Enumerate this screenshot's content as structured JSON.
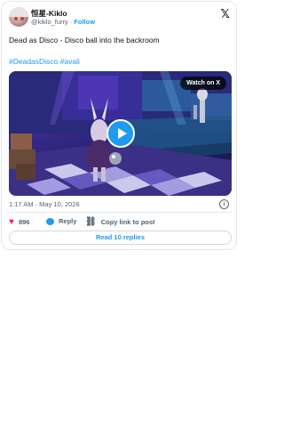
{
  "author": {
    "display_name": "恒星-Kiklo",
    "handle": "@kiklo_furry",
    "separator": "·",
    "follow_label": "Follow"
  },
  "brand_logo": "𝕏",
  "tweet": {
    "text": "Dead as Disco - Disco ball into the backroom",
    "hashtags": [
      "#DeadasDisco",
      "#avali"
    ]
  },
  "media": {
    "watch_label": "Watch on X",
    "play_icon": "play-icon"
  },
  "timestamp": "1:17 AM · May 10, 2026",
  "actions": {
    "like_count": "896",
    "reply_label": "Reply",
    "copy_link_label": "Copy link to post"
  },
  "read_replies_label": "Read 10 replies",
  "colors": {
    "accent": "#1d9bf0",
    "like": "#f91880",
    "muted": "#536471",
    "border": "#e4e8eb"
  }
}
